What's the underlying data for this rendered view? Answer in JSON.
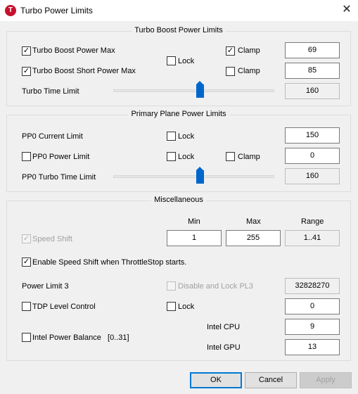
{
  "window": {
    "title": "Turbo Power Limits",
    "icon_glyph": "T"
  },
  "turbo": {
    "group_title": "Turbo Boost Power Limits",
    "boost_max_label": "Turbo Boost Power Max",
    "boost_max_checked": true,
    "boost_short_label": "Turbo Boost Short Power Max",
    "boost_short_checked": true,
    "lock_label": "Lock",
    "clamp1_label": "Clamp",
    "clamp1_checked": true,
    "clamp2_label": "Clamp",
    "clamp2_checked": false,
    "max_value": "69",
    "short_value": "85",
    "time_label": "Turbo Time Limit",
    "time_value": "160",
    "time_slider_fraction": 0.54
  },
  "pp0": {
    "group_title": "Primary Plane Power Limits",
    "current_label": "PP0 Current Limit",
    "current_lock_label": "Lock",
    "current_value": "150",
    "power_label": "PP0 Power Limit",
    "power_lock_label": "Lock",
    "power_clamp_label": "Clamp",
    "power_value": "0",
    "turbo_time_label": "PP0 Turbo Time Limit",
    "turbo_time_value": "160",
    "turbo_time_slider_fraction": 0.54
  },
  "misc": {
    "group_title": "Miscellaneous",
    "col_min": "Min",
    "col_max": "Max",
    "col_range": "Range",
    "speed_shift_label": "Speed Shift",
    "speed_shift_checked": true,
    "min_value": "1",
    "max_value": "255",
    "range_value": "1..41",
    "enable_speed_shift_label": "Enable Speed Shift when ThrottleStop starts.",
    "enable_speed_shift_checked": true,
    "pl3_label": "Power Limit 3",
    "pl3_disable_label": "Disable and Lock PL3",
    "pl3_value": "32828270",
    "tdp_label": "TDP Level Control",
    "tdp_lock_label": "Lock",
    "tdp_value": "0",
    "balance_label": "Intel Power Balance",
    "balance_range": "[0..31]",
    "cpu_label": "Intel CPU",
    "cpu_value": "9",
    "gpu_label": "Intel GPU",
    "gpu_value": "13"
  },
  "buttons": {
    "ok": "OK",
    "cancel": "Cancel",
    "apply": "Apply"
  },
  "colors": {
    "accent": "#0078d7",
    "slider": "#0066cc",
    "icon": "#c8102e"
  },
  "icons": {
    "check": "✓",
    "close": "✕"
  }
}
